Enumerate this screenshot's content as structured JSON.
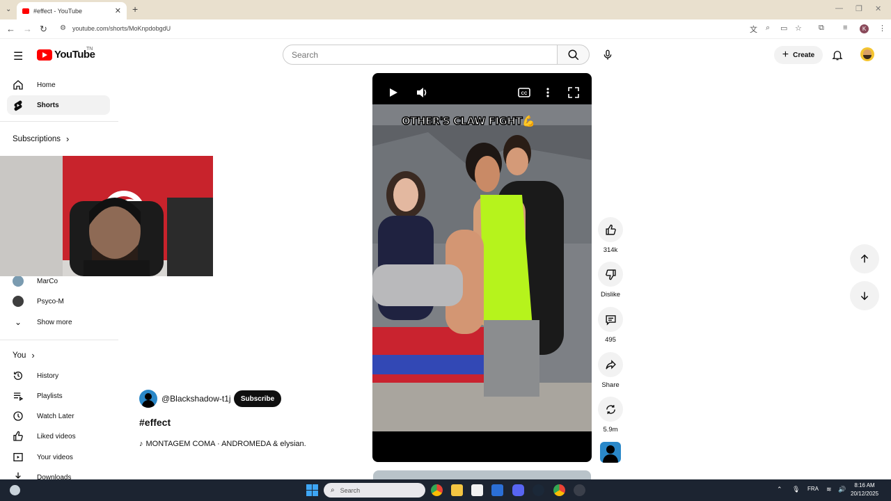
{
  "browser": {
    "tab_title": "#effect - YouTube",
    "url": "youtube.com/shorts/MoKnpdobgdU",
    "profile_initial": "K"
  },
  "header": {
    "logo_text": "YouTube",
    "country_code": "TN",
    "search_placeholder": "Search",
    "create_label": "Create"
  },
  "sidebar": {
    "top_items": [
      {
        "label": "Home",
        "icon": "home-icon"
      },
      {
        "label": "Shorts",
        "icon": "shorts-icon",
        "active": true
      }
    ],
    "subscriptions_heading": "Subscriptions",
    "subscriptions": [
      {
        "label": "MarCo"
      },
      {
        "label": "Psyco-M"
      }
    ],
    "show_more_label": "Show more",
    "you_heading": "You",
    "you_items": [
      {
        "label": "History",
        "icon": "history-icon"
      },
      {
        "label": "Playlists",
        "icon": "playlists-icon"
      },
      {
        "label": "Watch Later",
        "icon": "clock-icon"
      },
      {
        "label": "Liked videos",
        "icon": "thumb-up-icon"
      },
      {
        "label": "Your videos",
        "icon": "video-icon"
      },
      {
        "label": "Downloads",
        "icon": "download-icon"
      }
    ]
  },
  "short": {
    "channel_handle": "@Blackshadow-t1j",
    "subscribe_label": "Subscribe",
    "title": "#effect",
    "music": "MONTAGEM COMA · ANDROMEDA & elysian.",
    "caption_overlay": "OTHER'S CLAW FIGHT💪"
  },
  "actions": {
    "likes": "314k",
    "dislike_label": "Dislike",
    "comments": "495",
    "share_label": "Share",
    "remix_count": "5.9m"
  },
  "taskbar": {
    "search_placeholder": "Search",
    "language": "FRA",
    "time": "8:16 AM",
    "date": "20/12/2025"
  },
  "colors": {
    "youtube_red": "#ff0000",
    "active_bg": "#f2f2f2",
    "taskbar_bg": "#1c2431",
    "tabstrip_bg": "#e9e0ce"
  }
}
